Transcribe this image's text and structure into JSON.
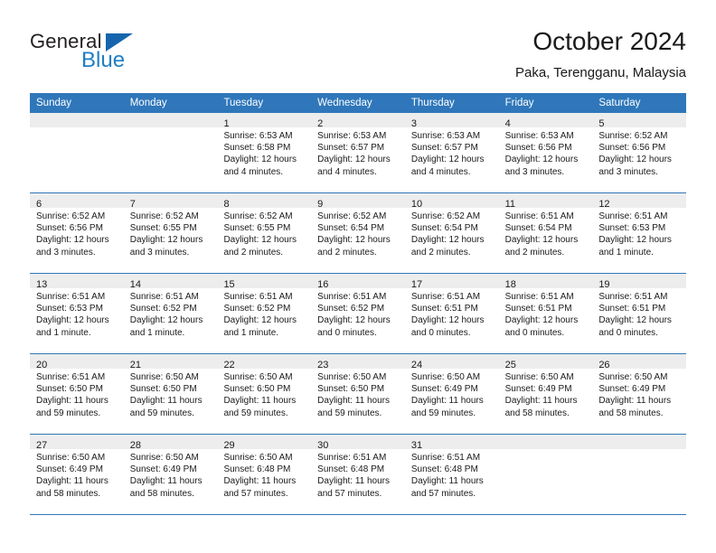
{
  "logo": {
    "word1": "General",
    "word2": "Blue",
    "triangle_color": "#1665ac",
    "blue_color": "#1e7fc4"
  },
  "header": {
    "title": "October 2024",
    "subtitle": "Paka, Terengganu, Malaysia"
  },
  "theme": {
    "header_blue": "#2f77ba",
    "band_gray": "#ededed",
    "text": "#1a1a1a"
  },
  "weekdays": [
    "Sunday",
    "Monday",
    "Tuesday",
    "Wednesday",
    "Thursday",
    "Friday",
    "Saturday"
  ],
  "weeks": [
    [
      {
        "empty": true
      },
      {
        "empty": true
      },
      {
        "day": "1",
        "sunrise": "Sunrise: 6:53 AM",
        "sunset": "Sunset: 6:58 PM",
        "daylight1": "Daylight: 12 hours",
        "daylight2": "and 4 minutes."
      },
      {
        "day": "2",
        "sunrise": "Sunrise: 6:53 AM",
        "sunset": "Sunset: 6:57 PM",
        "daylight1": "Daylight: 12 hours",
        "daylight2": "and 4 minutes."
      },
      {
        "day": "3",
        "sunrise": "Sunrise: 6:53 AM",
        "sunset": "Sunset: 6:57 PM",
        "daylight1": "Daylight: 12 hours",
        "daylight2": "and 4 minutes."
      },
      {
        "day": "4",
        "sunrise": "Sunrise: 6:53 AM",
        "sunset": "Sunset: 6:56 PM",
        "daylight1": "Daylight: 12 hours",
        "daylight2": "and 3 minutes."
      },
      {
        "day": "5",
        "sunrise": "Sunrise: 6:52 AM",
        "sunset": "Sunset: 6:56 PM",
        "daylight1": "Daylight: 12 hours",
        "daylight2": "and 3 minutes."
      }
    ],
    [
      {
        "day": "6",
        "sunrise": "Sunrise: 6:52 AM",
        "sunset": "Sunset: 6:56 PM",
        "daylight1": "Daylight: 12 hours",
        "daylight2": "and 3 minutes."
      },
      {
        "day": "7",
        "sunrise": "Sunrise: 6:52 AM",
        "sunset": "Sunset: 6:55 PM",
        "daylight1": "Daylight: 12 hours",
        "daylight2": "and 3 minutes."
      },
      {
        "day": "8",
        "sunrise": "Sunrise: 6:52 AM",
        "sunset": "Sunset: 6:55 PM",
        "daylight1": "Daylight: 12 hours",
        "daylight2": "and 2 minutes."
      },
      {
        "day": "9",
        "sunrise": "Sunrise: 6:52 AM",
        "sunset": "Sunset: 6:54 PM",
        "daylight1": "Daylight: 12 hours",
        "daylight2": "and 2 minutes."
      },
      {
        "day": "10",
        "sunrise": "Sunrise: 6:52 AM",
        "sunset": "Sunset: 6:54 PM",
        "daylight1": "Daylight: 12 hours",
        "daylight2": "and 2 minutes."
      },
      {
        "day": "11",
        "sunrise": "Sunrise: 6:51 AM",
        "sunset": "Sunset: 6:54 PM",
        "daylight1": "Daylight: 12 hours",
        "daylight2": "and 2 minutes."
      },
      {
        "day": "12",
        "sunrise": "Sunrise: 6:51 AM",
        "sunset": "Sunset: 6:53 PM",
        "daylight1": "Daylight: 12 hours",
        "daylight2": "and 1 minute."
      }
    ],
    [
      {
        "day": "13",
        "sunrise": "Sunrise: 6:51 AM",
        "sunset": "Sunset: 6:53 PM",
        "daylight1": "Daylight: 12 hours",
        "daylight2": "and 1 minute."
      },
      {
        "day": "14",
        "sunrise": "Sunrise: 6:51 AM",
        "sunset": "Sunset: 6:52 PM",
        "daylight1": "Daylight: 12 hours",
        "daylight2": "and 1 minute."
      },
      {
        "day": "15",
        "sunrise": "Sunrise: 6:51 AM",
        "sunset": "Sunset: 6:52 PM",
        "daylight1": "Daylight: 12 hours",
        "daylight2": "and 1 minute."
      },
      {
        "day": "16",
        "sunrise": "Sunrise: 6:51 AM",
        "sunset": "Sunset: 6:52 PM",
        "daylight1": "Daylight: 12 hours",
        "daylight2": "and 0 minutes."
      },
      {
        "day": "17",
        "sunrise": "Sunrise: 6:51 AM",
        "sunset": "Sunset: 6:51 PM",
        "daylight1": "Daylight: 12 hours",
        "daylight2": "and 0 minutes."
      },
      {
        "day": "18",
        "sunrise": "Sunrise: 6:51 AM",
        "sunset": "Sunset: 6:51 PM",
        "daylight1": "Daylight: 12 hours",
        "daylight2": "and 0 minutes."
      },
      {
        "day": "19",
        "sunrise": "Sunrise: 6:51 AM",
        "sunset": "Sunset: 6:51 PM",
        "daylight1": "Daylight: 12 hours",
        "daylight2": "and 0 minutes."
      }
    ],
    [
      {
        "day": "20",
        "sunrise": "Sunrise: 6:51 AM",
        "sunset": "Sunset: 6:50 PM",
        "daylight1": "Daylight: 11 hours",
        "daylight2": "and 59 minutes."
      },
      {
        "day": "21",
        "sunrise": "Sunrise: 6:50 AM",
        "sunset": "Sunset: 6:50 PM",
        "daylight1": "Daylight: 11 hours",
        "daylight2": "and 59 minutes."
      },
      {
        "day": "22",
        "sunrise": "Sunrise: 6:50 AM",
        "sunset": "Sunset: 6:50 PM",
        "daylight1": "Daylight: 11 hours",
        "daylight2": "and 59 minutes."
      },
      {
        "day": "23",
        "sunrise": "Sunrise: 6:50 AM",
        "sunset": "Sunset: 6:50 PM",
        "daylight1": "Daylight: 11 hours",
        "daylight2": "and 59 minutes."
      },
      {
        "day": "24",
        "sunrise": "Sunrise: 6:50 AM",
        "sunset": "Sunset: 6:49 PM",
        "daylight1": "Daylight: 11 hours",
        "daylight2": "and 59 minutes."
      },
      {
        "day": "25",
        "sunrise": "Sunrise: 6:50 AM",
        "sunset": "Sunset: 6:49 PM",
        "daylight1": "Daylight: 11 hours",
        "daylight2": "and 58 minutes."
      },
      {
        "day": "26",
        "sunrise": "Sunrise: 6:50 AM",
        "sunset": "Sunset: 6:49 PM",
        "daylight1": "Daylight: 11 hours",
        "daylight2": "and 58 minutes."
      }
    ],
    [
      {
        "day": "27",
        "sunrise": "Sunrise: 6:50 AM",
        "sunset": "Sunset: 6:49 PM",
        "daylight1": "Daylight: 11 hours",
        "daylight2": "and 58 minutes."
      },
      {
        "day": "28",
        "sunrise": "Sunrise: 6:50 AM",
        "sunset": "Sunset: 6:49 PM",
        "daylight1": "Daylight: 11 hours",
        "daylight2": "and 58 minutes."
      },
      {
        "day": "29",
        "sunrise": "Sunrise: 6:50 AM",
        "sunset": "Sunset: 6:48 PM",
        "daylight1": "Daylight: 11 hours",
        "daylight2": "and 57 minutes."
      },
      {
        "day": "30",
        "sunrise": "Sunrise: 6:51 AM",
        "sunset": "Sunset: 6:48 PM",
        "daylight1": "Daylight: 11 hours",
        "daylight2": "and 57 minutes."
      },
      {
        "day": "31",
        "sunrise": "Sunrise: 6:51 AM",
        "sunset": "Sunset: 6:48 PM",
        "daylight1": "Daylight: 11 hours",
        "daylight2": "and 57 minutes."
      },
      {
        "empty": true
      },
      {
        "empty": true
      }
    ]
  ]
}
